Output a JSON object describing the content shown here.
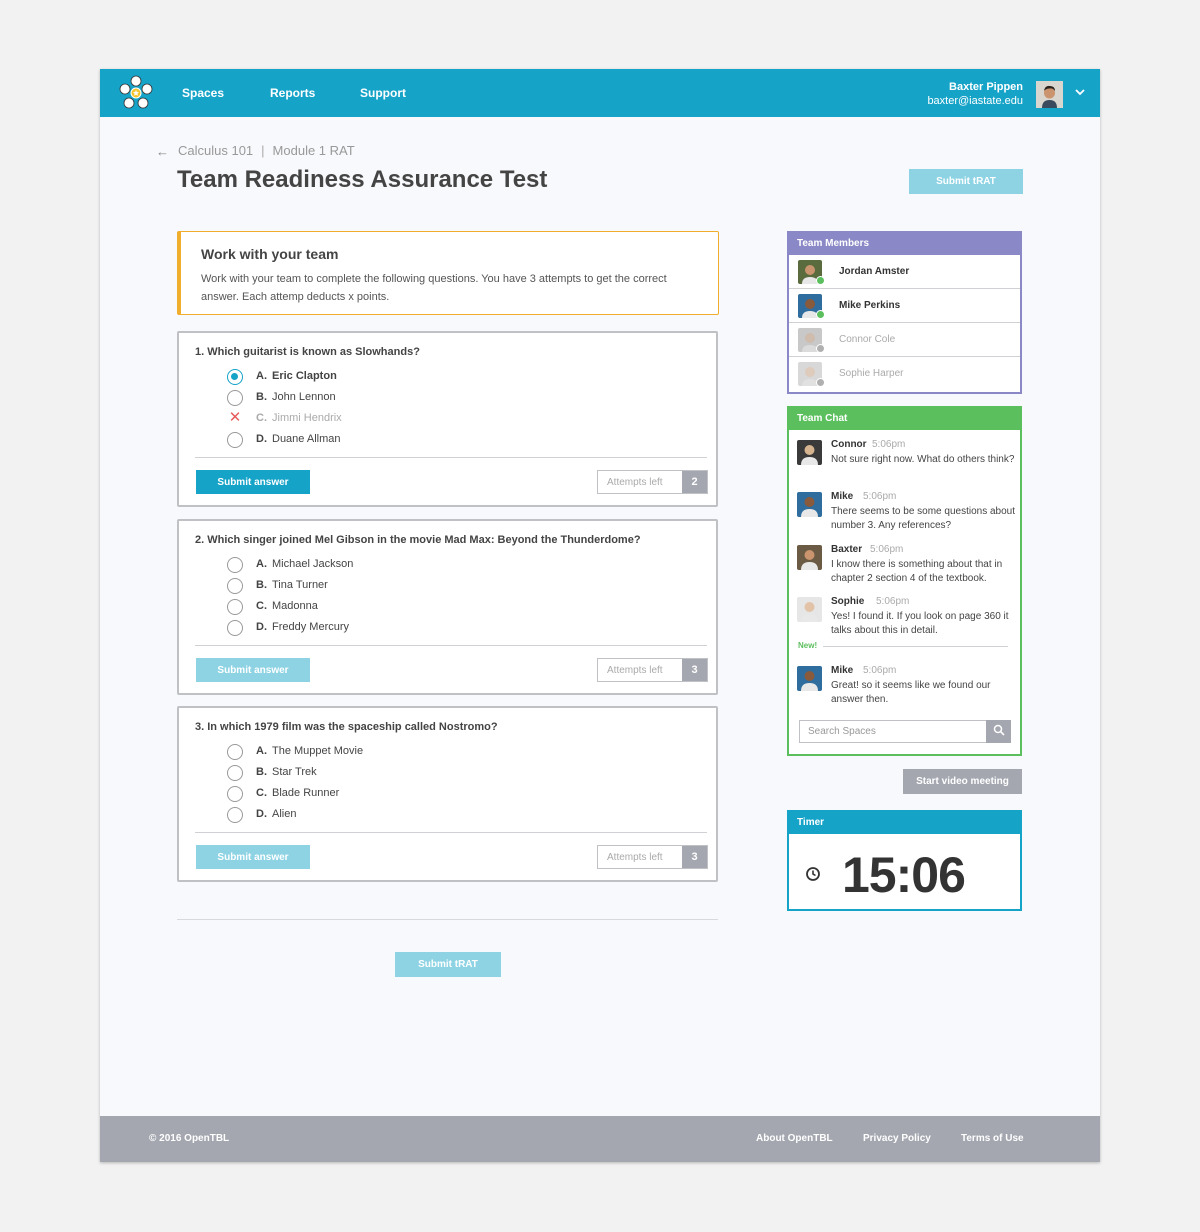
{
  "nav": {
    "items": [
      "Spaces",
      "Reports",
      "Support"
    ]
  },
  "user": {
    "name": "Baxter Pippen",
    "email": "baxter@iastate.edu"
  },
  "breadcrumb": {
    "course": "Calculus 101",
    "separator": "|",
    "module": "Module 1 RAT"
  },
  "page": {
    "title": "Team Readiness Assurance Test",
    "submit_label": "Submit tRAT"
  },
  "info": {
    "title": "Work with your team",
    "text": "Work with your team to complete the following questions. You have 3 attempts to get the correct answer. Each attemp deducts x points."
  },
  "questions": [
    {
      "title": "1. Which guitarist is known as Slowhands?",
      "options": [
        {
          "letter": "A.",
          "text": "Eric Clapton",
          "state": "selected"
        },
        {
          "letter": "B.",
          "text": "John Lennon",
          "state": "normal"
        },
        {
          "letter": "C.",
          "text": "Jimmi Hendrix",
          "state": "wrong"
        },
        {
          "letter": "D.",
          "text": "Duane Allman",
          "state": "normal"
        }
      ],
      "submit_label": "Submit answer",
      "attempts_label": "Attempts left",
      "attempts_left": "2"
    },
    {
      "title": "2.  Which singer joined Mel Gibson in the movie Mad Max: Beyond the Thunderdome?",
      "options": [
        {
          "letter": "A.",
          "text": "Michael Jackson",
          "state": "normal"
        },
        {
          "letter": "B.",
          "text": "Tina Turner",
          "state": "normal"
        },
        {
          "letter": "C.",
          "text": "Madonna",
          "state": "normal"
        },
        {
          "letter": "D.",
          "text": "Freddy Mercury",
          "state": "normal"
        }
      ],
      "submit_label": "Submit answer",
      "attempts_label": "Attempts left",
      "attempts_left": "3"
    },
    {
      "title": "3.  In which 1979 film was the spaceship called Nostromo?",
      "options": [
        {
          "letter": "A.",
          "text": "The Muppet Movie",
          "state": "normal"
        },
        {
          "letter": "B.",
          "text": "Star Trek",
          "state": "normal"
        },
        {
          "letter": "C.",
          "text": "Blade Runner",
          "state": "normal"
        },
        {
          "letter": "D.",
          "text": "Alien",
          "state": "normal"
        }
      ],
      "submit_label": "Submit answer",
      "attempts_label": "Attempts left",
      "attempts_left": "3"
    }
  ],
  "team_members": {
    "title": "Team Members",
    "members": [
      {
        "name": "Jordan Amster",
        "status": "online"
      },
      {
        "name": "Mike Perkins",
        "status": "online"
      },
      {
        "name": "Connor Cole",
        "status": "offline"
      },
      {
        "name": "Sophie Harper",
        "status": "offline"
      }
    ]
  },
  "team_chat": {
    "title": "Team Chat",
    "messages": [
      {
        "author": "Connor",
        "time": "5:06pm",
        "text": "Not sure right now. What do others think?"
      },
      {
        "author": "Mike",
        "time": "5:06pm",
        "text": "There seems to be some questions about number 3. Any references?"
      },
      {
        "author": "Baxter",
        "time": "5:06pm",
        "text": "I know there is something about that in chapter 2 section 4 of the textbook."
      },
      {
        "author": "Sophie",
        "time": "5:06pm",
        "text": "Yes! I found it. If you look on page 360 it talks about this in detail."
      },
      {
        "author": "Mike",
        "time": "5:06pm",
        "text": "Great! so it seems like we found our answer then."
      }
    ],
    "new_label": "New!",
    "search_placeholder": "Search Spaces"
  },
  "video": {
    "label": "Start video meeting"
  },
  "timer": {
    "title": "Timer",
    "value": "15:06"
  },
  "footer": {
    "copyright": "© 2016 OpenTBL",
    "links": [
      "About OpenTBL",
      "Privacy Policy",
      "Terms of Use"
    ]
  },
  "colors": {
    "primary": "#16a3c8",
    "primary_disabled": "#8dd3e4",
    "members_header": "#8a88c6",
    "chat_header": "#5cbf5e",
    "warning_border": "#f0ae2c",
    "wrong": "#e65c5c",
    "footer": "#a4a7b0",
    "online": "#5cbf5e",
    "offline": "#b0b0b0"
  }
}
